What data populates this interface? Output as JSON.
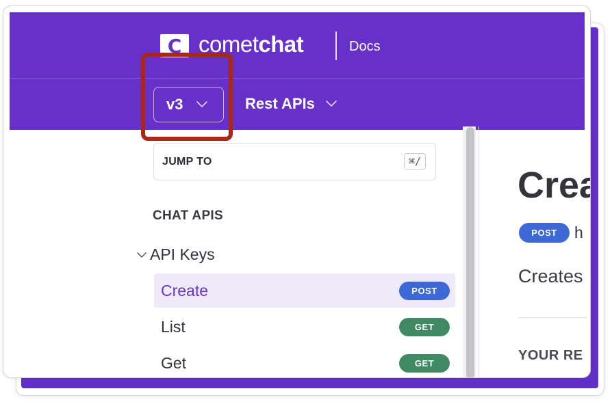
{
  "header": {
    "brand_light": "comet",
    "brand_bold": "chat",
    "logo_letter": "C",
    "section": "Docs",
    "version": "v3",
    "product_menu": "Rest APIs",
    "colors": {
      "brand_purple": "#6731c9",
      "highlight_red": "#a82818"
    }
  },
  "sidebar": {
    "jump_to": "JUMP TO",
    "shortcut": "⌘/",
    "section_title": "CHAT APIS",
    "group_label": "API Keys",
    "items": [
      {
        "label": "Create",
        "method": "POST",
        "active": true
      },
      {
        "label": "List",
        "method": "GET",
        "active": false
      },
      {
        "label": "Get",
        "method": "GET",
        "active": false
      }
    ]
  },
  "content": {
    "title": "Crea",
    "method": "POST",
    "url": "h",
    "description": "Creates",
    "subheading": "YOUR RE"
  }
}
